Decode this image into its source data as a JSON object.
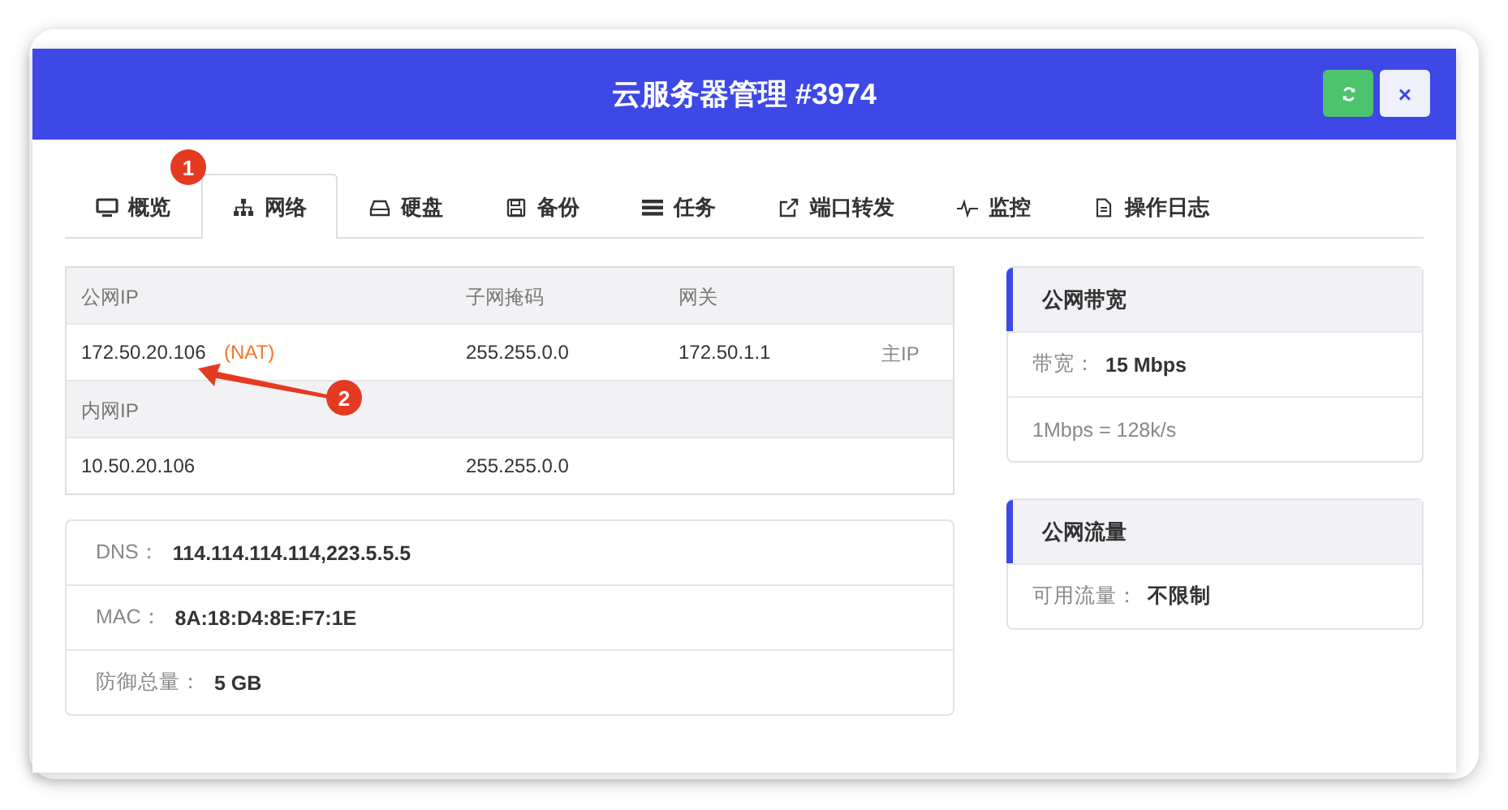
{
  "window": {
    "title": "云服务器管理 #3974"
  },
  "header_buttons": [
    {
      "kind": "refresh"
    },
    {
      "kind": "close",
      "label": "×"
    }
  ],
  "tabs": [
    {
      "label": "概览",
      "selected": false
    },
    {
      "label": "网络",
      "selected": true
    },
    {
      "label": "硬盘",
      "selected": false
    },
    {
      "label": "备份",
      "selected": false
    },
    {
      "label": "任务",
      "selected": false
    },
    {
      "label": "端口转发",
      "selected": false
    },
    {
      "label": "监控",
      "selected": false
    },
    {
      "label": "操作日志",
      "selected": false
    }
  ],
  "network_table": {
    "rows": [
      {
        "kind": "header",
        "cells": [
          "公网IP",
          "子网掩码",
          "网关"
        ]
      },
      {
        "kind": "data",
        "cells": [
          "172.50.20.106",
          "255.255.0.0",
          "172.50.1.1"
        ],
        "tag": "(NAT)",
        "note": "主IP"
      },
      {
        "kind": "header",
        "cells": [
          "内网IP"
        ]
      },
      {
        "kind": "data",
        "cells": [
          "10.50.20.106",
          "255.255.0.0"
        ]
      }
    ]
  },
  "info": [
    {
      "label": "DNS：",
      "value": "114.114.114.114,223.5.5.5"
    },
    {
      "label": "MAC：",
      "value": "8A:18:D4:8E:F7:1E"
    },
    {
      "label": "防御总量：",
      "value": "5 GB"
    }
  ],
  "side_cards": [
    {
      "title": "公网带宽",
      "rows": [
        {
          "label": "带宽：",
          "value": "15 Mbps"
        },
        {
          "text": "1Mbps = 128k/s"
        }
      ]
    },
    {
      "title": "公网流量",
      "rows": [
        {
          "label": "可用流量：",
          "value": "不限制"
        }
      ]
    }
  ],
  "annotations": [
    {
      "label": "1"
    },
    {
      "label": "2"
    }
  ]
}
